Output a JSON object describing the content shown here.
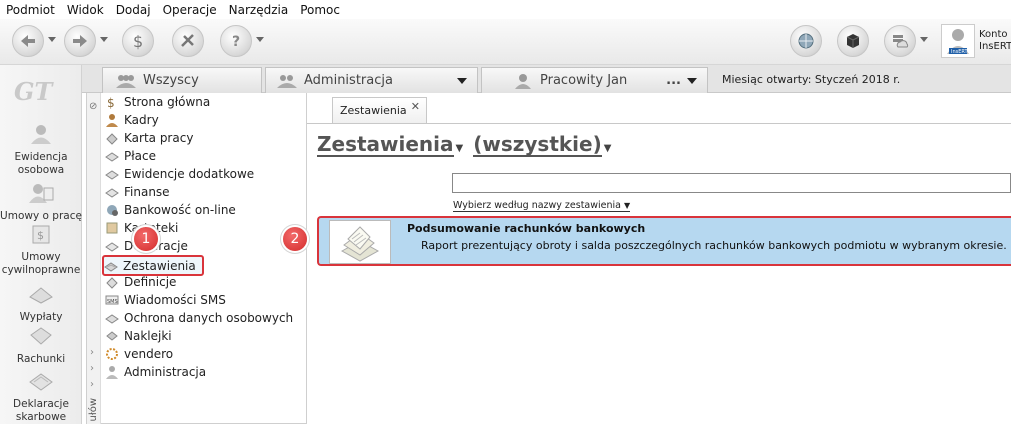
{
  "menu": [
    "Podmiot",
    "Widok",
    "Dodaj",
    "Operacje",
    "Narzędzia",
    "Pomoc"
  ],
  "account": {
    "line1": "Konto",
    "line2": "InsERT",
    "avatar_label": "InsERT"
  },
  "app_logo": "GT",
  "leftnav": [
    {
      "label1": "Ewidencja",
      "label2": "osobowa",
      "icon": "person-icon"
    },
    {
      "label1": "Umowy o pracę",
      "label2": "",
      "icon": "person-contract-icon"
    },
    {
      "label1": "Umowy",
      "label2": "cywilnoprawne",
      "icon": "contract-icon"
    },
    {
      "label1": "Wypłaty",
      "label2": "",
      "icon": "payout-icon"
    },
    {
      "label1": "Rachunki",
      "label2": "",
      "icon": "bill-icon"
    },
    {
      "label1": "Deklaracje",
      "label2": "skarbowe",
      "icon": "declaration-icon"
    }
  ],
  "tabs": {
    "all": "Wszyscy",
    "admin": "Administracja",
    "employee": "Pracowity Jan",
    "employee_more": "...",
    "month_label": "Miesiąc otwarty:",
    "month_value": "Styczeń 2018 r."
  },
  "tree": {
    "items": [
      "Strona główna",
      "Kadry",
      "Karta pracy",
      "Płace",
      "Ewidencje dodatkowe",
      "Finanse",
      "Bankowość on-line",
      "Kartoteki",
      "Deklaracje",
      "Zestawienia",
      "Definicje",
      "Wiadomości SMS",
      "Ochrona danych osobowych",
      "Naklejki",
      "vendero",
      "Administracja"
    ],
    "selected": "Zestawienia",
    "vertical_label": "ułów"
  },
  "content": {
    "doc_tab": "Zestawienia",
    "title": "Zestawienia",
    "title_filter": "(wszystkie)",
    "search_value": "",
    "filter_label": "Wybierz według nazwy zestawienia",
    "result_title": "Podsumowanie rachunków bankowych",
    "result_desc": "Raport prezentujący obroty i salda poszczególnych rachunków bankowych podmiotu w wybranym okresie."
  },
  "annotations": [
    "1",
    "2"
  ],
  "colors": {
    "highlight_border": "#d9343b",
    "result_bg": "#b6d8f0",
    "badge": "#d42a2a"
  }
}
